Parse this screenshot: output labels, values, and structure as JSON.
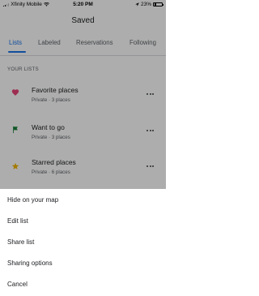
{
  "status_bar": {
    "carrier": "Xfinity Mobile",
    "time": "5:20 PM",
    "battery_percent": "23%",
    "battery_level": 0.23
  },
  "header": {
    "title": "Saved"
  },
  "tabs": [
    {
      "label": "Lists",
      "active": true
    },
    {
      "label": "Labeled",
      "active": false
    },
    {
      "label": "Reservations",
      "active": false
    },
    {
      "label": "Following",
      "active": false
    }
  ],
  "section": {
    "label": "YOUR LISTS"
  },
  "lists": [
    {
      "title": "Favorite places",
      "subtitle": "Private · 3 places",
      "icon": "heart-icon",
      "color": "#e8457a"
    },
    {
      "title": "Want to go",
      "subtitle": "Private · 3 places",
      "icon": "flag-icon",
      "color": "#188038"
    },
    {
      "title": "Starred places",
      "subtitle": "Private · 6 places",
      "icon": "star-icon",
      "color": "#f4b400"
    }
  ],
  "bottom_sheet": {
    "items": [
      {
        "label": "Hide on your map"
      },
      {
        "label": "Edit list"
      },
      {
        "label": "Share list"
      },
      {
        "label": "Sharing options"
      },
      {
        "label": "Cancel"
      }
    ]
  },
  "colors": {
    "accent": "#1a73e8",
    "overlay": "rgba(0,0,0,0.32)"
  }
}
